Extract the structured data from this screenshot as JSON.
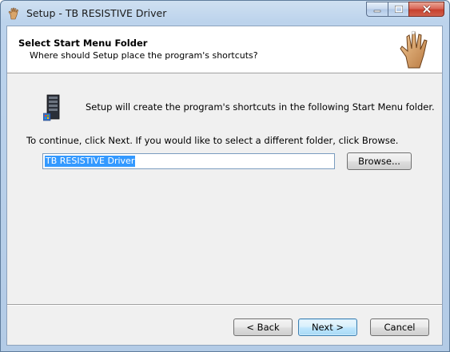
{
  "window": {
    "title": "Setup - TB RESISTIVE Driver"
  },
  "header": {
    "title": "Select Start Menu Folder",
    "subtitle": "Where should Setup place the program's shortcuts?"
  },
  "body": {
    "info_text": "Setup will create the program's shortcuts in the following Start Menu folder.",
    "continue_text": "To continue, click Next. If you would like to select a different folder, click Browse.",
    "folder_value": "TB RESISTIVE Driver",
    "browse_label": "Browse..."
  },
  "footer": {
    "back_label": "< Back",
    "next_label": "Next >",
    "cancel_label": "Cancel"
  },
  "icons": {
    "title_icon": "hand-icon",
    "header_icon": "hand-icon",
    "folder_icon": "start-menu-folder-icon",
    "minimize": "minimize-icon",
    "maximize": "maximize-icon",
    "close": "close-icon"
  },
  "colors": {
    "selection": "#3399ff",
    "close_button": "#c7402d",
    "default_button_border": "#3c7fb1"
  }
}
